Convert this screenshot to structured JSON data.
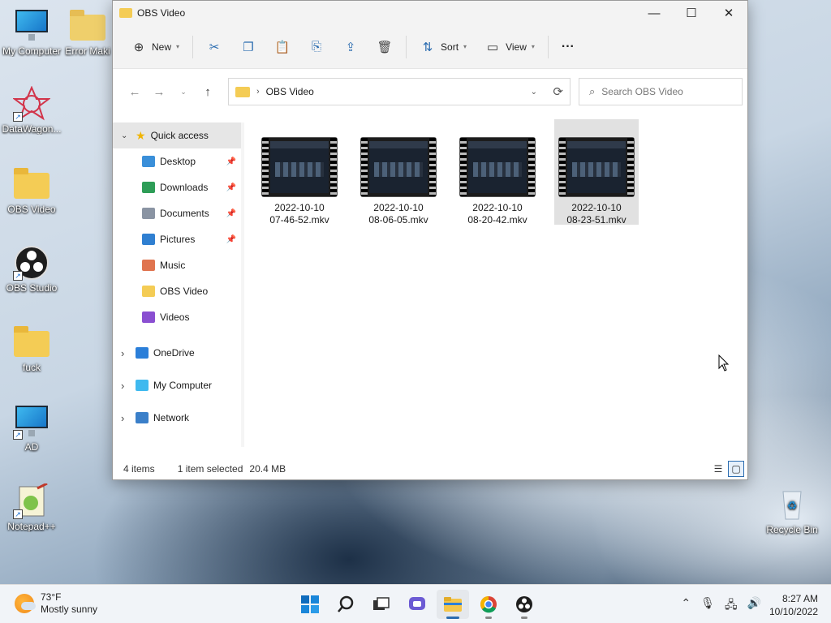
{
  "desktop": {
    "icons": [
      {
        "label": "My Computer"
      },
      {
        "label": "Error Maki"
      },
      {
        "label": "DataWagon..."
      },
      {
        "label": "OBS Video"
      },
      {
        "label": "OBS Studio"
      },
      {
        "label": "fuck"
      },
      {
        "label": "AD"
      },
      {
        "label": "Notepad++"
      },
      {
        "label": "Recycle Bin"
      }
    ]
  },
  "window": {
    "title": "OBS Video",
    "controls": {
      "minimize": "—",
      "maximize": "☐",
      "close": "✕"
    },
    "toolbar": {
      "new_label": "New",
      "sort_label": "Sort",
      "view_label": "View",
      "more_label": "···"
    },
    "address": {
      "path": "OBS Video"
    },
    "search": {
      "placeholder": "Search OBS Video"
    },
    "sidebar": {
      "quick_access": "Quick access",
      "items": [
        {
          "label": "Desktop",
          "pinned": true,
          "color": "#3a8fd9"
        },
        {
          "label": "Downloads",
          "pinned": true,
          "color": "#2e9d57"
        },
        {
          "label": "Documents",
          "pinned": true,
          "color": "#8a94a3"
        },
        {
          "label": "Pictures",
          "pinned": true,
          "color": "#2f7fd1"
        },
        {
          "label": "Music",
          "pinned": false,
          "color": "#e0744f"
        },
        {
          "label": "OBS Video",
          "pinned": false,
          "color": "#f4cc55"
        },
        {
          "label": "Videos",
          "pinned": false,
          "color": "#8a4fd1"
        }
      ],
      "roots": [
        {
          "label": "OneDrive",
          "color": "#2b7fd9"
        },
        {
          "label": "My Computer",
          "color": "#3fb9ef"
        },
        {
          "label": "Network",
          "color": "#3a7fc9"
        }
      ]
    },
    "files": [
      {
        "line1": "2022-10-10",
        "line2": "07-46-52.mkv",
        "selected": false
      },
      {
        "line1": "2022-10-10",
        "line2": "08-06-05.mkv",
        "selected": false
      },
      {
        "line1": "2022-10-10",
        "line2": "08-20-42.mkv",
        "selected": false
      },
      {
        "line1": "2022-10-10",
        "line2": "08-23-51.mkv",
        "selected": true
      }
    ],
    "status": {
      "count": "4 items",
      "selection": "1 item selected",
      "size": "20.4 MB"
    }
  },
  "taskbar": {
    "weather": {
      "temp": "73°F",
      "desc": "Mostly sunny"
    },
    "clock": {
      "time": "8:27 AM",
      "date": "10/10/2022"
    },
    "apps": [
      "start",
      "search",
      "task-view",
      "teams-chat",
      "file-explorer",
      "chrome",
      "obs-studio"
    ]
  }
}
